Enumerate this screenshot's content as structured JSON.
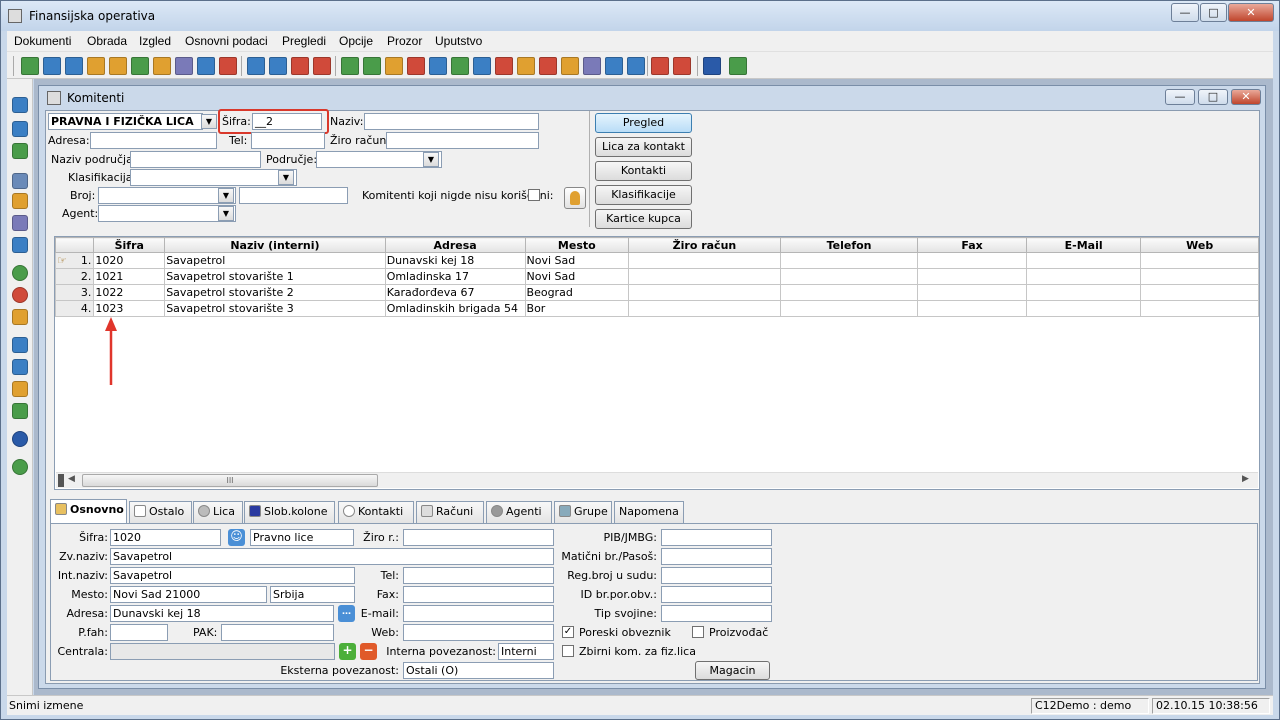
{
  "app": {
    "title": "Finansijska operativa"
  },
  "menu": [
    "Dokumenti",
    "Obrada",
    "Izgled",
    "Osnovni podaci",
    "Pregledi",
    "Opcije",
    "Prozor",
    "Uputstvo"
  ],
  "child_window": {
    "title": "Komitenti"
  },
  "filter": {
    "type_value": "PRAVNA I FIZIČKA LICA",
    "sifra_label": "Šifra:",
    "sifra_value": "__2",
    "naziv_label": "Naziv:",
    "adresa_label": "Adresa:",
    "tel_label": "Tel:",
    "ziro_label": "Žiro račun:",
    "naziv_podrucja_label": "Naziv područja:",
    "podrucje_label": "Područje:",
    "klasifikacija_label": "Klasifikacija:",
    "broj_label": "Broj:",
    "agent_label": "Agent:",
    "unused_label": "Komitenti koji nigde nisu korišćeni:"
  },
  "side_buttons": [
    "Pregled",
    "Lica za kontakt",
    "Kontakti",
    "Klasifikacije",
    "Kartice kupca"
  ],
  "grid": {
    "columns": [
      "Šifra",
      "Naziv (interni)",
      "Adresa",
      "Mesto",
      "Žiro račun",
      "Telefon",
      "Fax",
      "E-Mail",
      "Web"
    ],
    "rows": [
      {
        "n": "1.",
        "sifra": "1020",
        "naziv": "Savapetrol",
        "adresa": "Dunavski kej 18",
        "mesto": "Novi Sad"
      },
      {
        "n": "2.",
        "sifra": "1021",
        "naziv": "Savapetrol stovarište 1",
        "adresa": "Omladinska 17",
        "mesto": "Novi Sad"
      },
      {
        "n": "3.",
        "sifra": "1022",
        "naziv": "Savapetrol stovarište 2",
        "adresa": "Karađorđeva 67",
        "mesto": "Beograd"
      },
      {
        "n": "4.",
        "sifra": "1023",
        "naziv": "Savapetrol stovarište 3",
        "adresa": "Omladinskih brigada 54",
        "mesto": "Bor"
      }
    ],
    "scroll_grip": "III"
  },
  "tabs": [
    "Osnovno",
    "Ostalo",
    "Lica",
    "Slob.kolone",
    "Kontakti",
    "Računi",
    "Agenti",
    "Grupe",
    "Napomena"
  ],
  "detail": {
    "sifra_label": "Šifra:",
    "sifra": "1020",
    "tip": "Pravno lice",
    "zvnaziv_label": "Zv.naziv:",
    "zvnaziv": "Savapetrol",
    "intnaziv_label": "Int.naziv:",
    "intnaziv": "Savapetrol",
    "mesto_label": "Mesto:",
    "mesto": "Novi Sad  21000",
    "drzava": "Srbija",
    "adresa_label": "Adresa:",
    "adresa": "Dunavski kej 18",
    "pfah_label": "P.fah:",
    "pak_label": "PAK:",
    "centrala_label": "Centrala:",
    "ziro_label": "Žiro r.:",
    "tel_label": "Tel:",
    "fax_label": "Fax:",
    "email_label": "E-mail:",
    "web_label": "Web:",
    "interna_label": "Interna povezanost:",
    "interna": "Interni",
    "eksterna_label": "Eksterna povezanost:",
    "eksterna": "Ostali (O)",
    "pib_label": "PIB/JMBG:",
    "maticni_label": "Matični br./Pasoš:",
    "regbroj_label": "Reg.broj u sudu:",
    "idbr_label": "ID br.por.obv.:",
    "tipsvojine_label": "Tip svojine:",
    "poreski_label": "Poreski obveznik",
    "proizvodjac_label": "Proizvođač",
    "zbirni_label": "Zbirni kom. za fiz.lica",
    "magacin_label": "Magacin"
  },
  "status": {
    "left": "Snimi izmene",
    "user": "C12Demo : demo",
    "datetime": "02.10.15 10:38:56"
  },
  "colors": {
    "accent": "#3c7fb1",
    "highlight_box": "#d9382b",
    "arrow": "#e0352b"
  }
}
